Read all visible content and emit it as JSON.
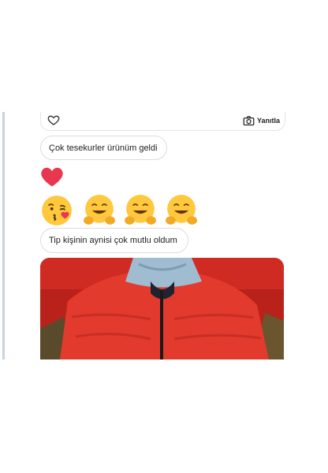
{
  "thread": {
    "reply_label": "Yanıtla",
    "messages": [
      {
        "text": "Çok tesekurler ürünüm geldi"
      },
      {
        "text": "Tip kişinin aynisi çok mutlu oldum"
      }
    ],
    "reactions": {
      "heart_icon": "heart-icon",
      "emojis": [
        "kissing-face-with-heart-emoji",
        "hugging-face-emoji",
        "hugging-face-emoji",
        "hugging-face-emoji"
      ]
    },
    "photo": {
      "subject": "red-puffer-jacket-photo"
    }
  },
  "colors": {
    "heart": "#e8384f",
    "emoji_yellow": "#ffc83d",
    "jacket_red": "#e23a2c",
    "hood_blue": "#9fbcd0",
    "border": "#dcdcdc"
  }
}
